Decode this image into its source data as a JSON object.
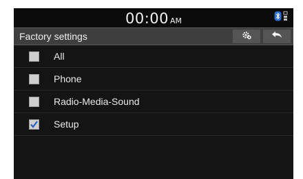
{
  "status": {
    "time": "00:00",
    "ampm": "AM",
    "icons": [
      "bluetooth-icon",
      "phone-signal-icon"
    ]
  },
  "header": {
    "title": "Factory settings",
    "buttons": [
      "settings-gear-icon",
      "back-arrow-icon"
    ]
  },
  "items": [
    {
      "label": "All",
      "checked": false
    },
    {
      "label": "Phone",
      "checked": false
    },
    {
      "label": "Radio-Media-Sound",
      "checked": false
    },
    {
      "label": "Setup",
      "checked": true
    }
  ],
  "colors": {
    "background": "#141414",
    "titlebar": "#3e3e3e",
    "check": "#2a5fc4"
  }
}
